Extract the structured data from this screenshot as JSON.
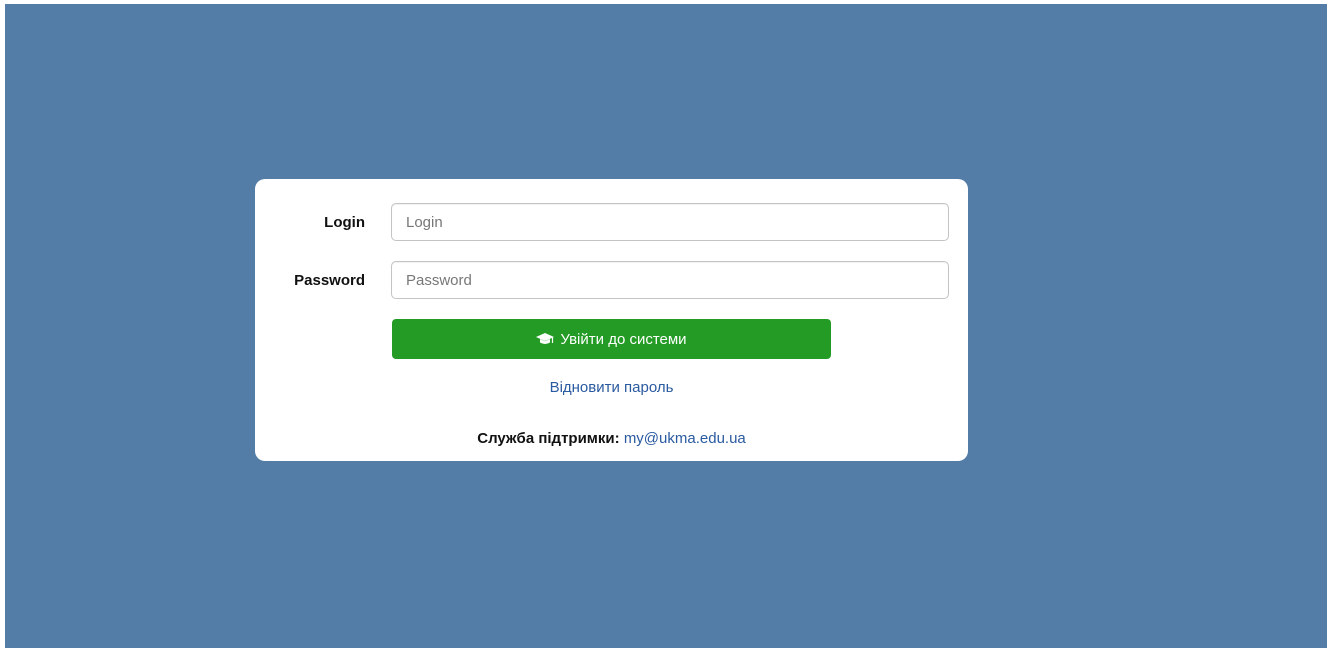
{
  "login_form": {
    "login_label": "Login",
    "login_placeholder": "Login",
    "login_value": "",
    "password_label": "Password",
    "password_placeholder": "Password",
    "password_value": "",
    "submit_label": "Увійти до системи",
    "submit_icon": "graduation-cap-icon",
    "restore_password_link": "Відновити пароль",
    "support_label": "Служба підтримки:",
    "support_email": "my@ukma.edu.ua"
  },
  "colors": {
    "background": "#537ca6",
    "card": "#ffffff",
    "button": "#239b24",
    "link": "#2a5aa0"
  }
}
